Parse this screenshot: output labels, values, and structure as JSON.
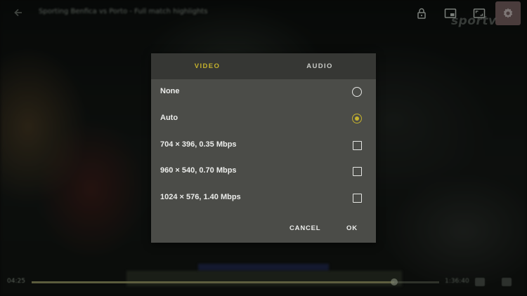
{
  "player": {
    "video_title": "Sporting Benfica vs Porto - Full match highlights",
    "watermark": "sportv",
    "time_current": "04:25",
    "time_total": "1:36:40",
    "progress": 0.89
  },
  "icons": {
    "back": "arrow-left-icon",
    "lock": "lock-icon",
    "pip": "picture-in-picture-icon",
    "aspect": "aspect-ratio-icon",
    "settings": "gear-icon"
  },
  "colors": {
    "accent": "#c5b22d",
    "dialog_bg": "#4b4c48",
    "tab_bar_bg": "#363734",
    "settings_button_bg": "#4a3c3c"
  },
  "dialog": {
    "tabs": [
      {
        "label": "VIDEO",
        "active": true
      },
      {
        "label": "AUDIO",
        "active": false
      }
    ],
    "options": [
      {
        "label": "None",
        "control": "radio",
        "selected": false
      },
      {
        "label": "Auto",
        "control": "radio",
        "selected": true
      },
      {
        "label": "704 × 396, 0.35 Mbps",
        "control": "checkbox",
        "selected": false
      },
      {
        "label": "960 × 540, 0.70 Mbps",
        "control": "checkbox",
        "selected": false
      },
      {
        "label": "1024 × 576, 1.40 Mbps",
        "control": "checkbox",
        "selected": false
      }
    ],
    "cancel_label": "CANCEL",
    "ok_label": "OK"
  }
}
